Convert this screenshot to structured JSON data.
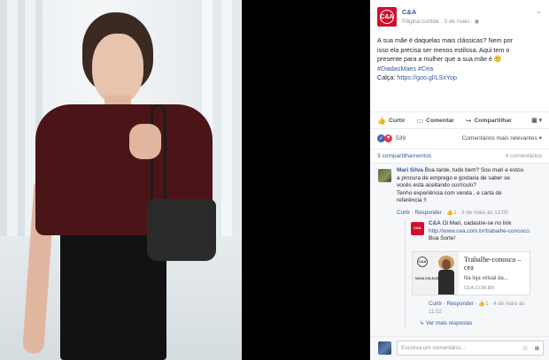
{
  "post": {
    "page_name": "C&A",
    "logo_text": "C&A",
    "meta": "Página curtida · 3 de maio · ",
    "body_lines": [
      "A sua mãe é daquelas mais clássicas? Nem por",
      "isso ela precisa ser menos estilosa. Aqui tem o",
      "presente para a mulher que a sua mãe é 🙂"
    ],
    "hashtags": "#DiadasMaes #Cea",
    "link_label": "Calça: ",
    "link_url": "https://goo.gl/LSxYop"
  },
  "actions": {
    "like": "Curtir",
    "comment": "Comentar",
    "share": "Compartilhar"
  },
  "stats": {
    "reactions_count": "539",
    "sort_label": "Comentários mais relevantes ▾",
    "shares": "3 compartilhamentos",
    "comments_count": "4 comentários"
  },
  "comments": [
    {
      "author": "Mari Silva",
      "lines": [
        " Boa tarde, tudo bem? Sou mari e estou",
        "a procura de emprego e gostaria de saber se",
        "vocês está aceitando currículo?",
        "Tenho experiência com venda , e carta de",
        "referência !!"
      ],
      "actions": "Curtir · Responder · ",
      "likes": "1",
      "date": " · 3 de maio às 13:05"
    },
    {
      "author": "C&A",
      "lines": [
        " Oi Mari, cadastre-se no link",
        "http://www.cea.com.br/trabalhe-conosco.",
        "Boa Sorte!"
      ],
      "actions": "Curtir · Responder · ",
      "likes": "1",
      "date": " · 4 de maio às",
      "date2": "11:52"
    }
  ],
  "link_preview": {
    "logo": "C&A",
    "tag": "NOVA COLEÇÃO",
    "title": "Trabalhe-conosco – cea",
    "desc": "Na loja virtual da...",
    "url": "CEA.COM.BR"
  },
  "more_replies": "↳ Ver mais respostas",
  "composer": {
    "placeholder": "Escreva um comentário..."
  },
  "colors": {
    "brand_red": "#d0102b",
    "link_blue": "#365899"
  }
}
